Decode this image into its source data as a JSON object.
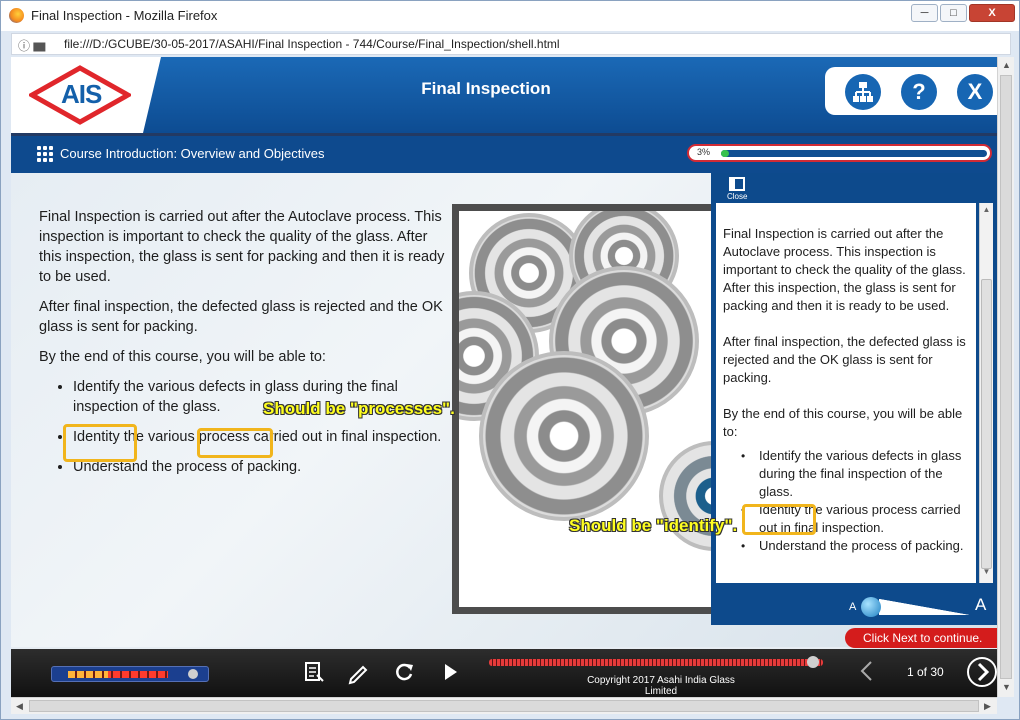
{
  "window": {
    "title": "Final Inspection - Mozilla Firefox",
    "minimize": "─",
    "maximize": "□",
    "close": "X"
  },
  "urlbar": {
    "url": "file:///D:/GCUBE/30-05-2017/ASAHI/Final Inspection - 744/Course/Final_Inspection/shell.html"
  },
  "header": {
    "logo_text": "AIS",
    "title": "Final Inspection",
    "tools": {
      "sitemap_icon": "sitemap-icon",
      "help": "?",
      "exit": "X"
    }
  },
  "subbar": {
    "section_title": "Course Introduction: Overview and Objectives",
    "progress_label": "3%",
    "progress_value": 0.03
  },
  "content": {
    "p1": "Final Inspection is carried out after the Autoclave process. This inspection is important to check the quality of the glass. After this inspection, the glass is sent for packing and then it is ready to be used.",
    "p2": "After final inspection, the defected glass is rejected and the OK glass is sent for packing.",
    "p3": "By the end of this course, you will be able to:",
    "bullets": [
      "Identify the various defects in glass during the final inspection of the glass.",
      "Identity the various process carried out in final inspection.",
      "Understand the process of packing."
    ]
  },
  "transcript": {
    "close_label": "Close",
    "p1": "Final Inspection is carried out after the Autoclave process. This inspection is important to check the quality of the glass. After this inspection, the glass is sent for packing and then it is ready to be used.",
    "p2": "After final inspection, the defected glass is rejected and the OK glass is sent for packing.",
    "p3": "By the end of this course, you will be able to:",
    "bullets": [
      "Identify the various defects in glass during the final inspection of the glass.",
      "Identity the various process carried out in final inspection.",
      "Understand the process of packing."
    ],
    "font_small": "A",
    "font_large": "A"
  },
  "next_hint": "Click Next to continue.",
  "annotations": {
    "note1": "Should be \"processes\".",
    "note2": "Should be \"identify\"."
  },
  "footer": {
    "copyright": "Copyright 2017 Asahi India Glass Limited",
    "page_indicator": "1 of 30",
    "audio_level": 0.4,
    "seek_position": 0.97
  },
  "colors": {
    "header_blue": "#1766b3",
    "accent_red": "#d41c1c",
    "highlight": "#f1b51c",
    "note_yellow": "#ffff20"
  }
}
